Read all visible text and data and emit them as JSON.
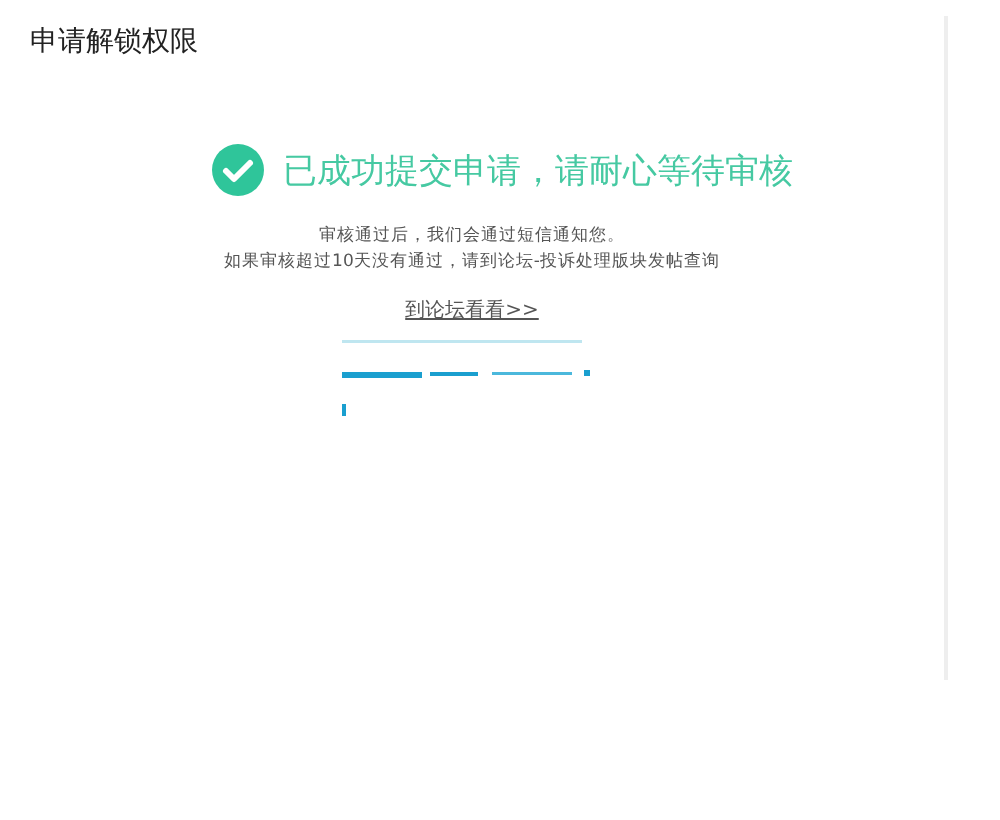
{
  "page": {
    "title": "申请解锁权限"
  },
  "result": {
    "message": "已成功提交申请，请耐心等待审核",
    "notes": [
      "审核通过后，我们会通过短信通知您。",
      "如果审核超过10天没有通过，请到论坛-投诉处理版块发帖查询"
    ],
    "link": "到论坛看看>>"
  }
}
